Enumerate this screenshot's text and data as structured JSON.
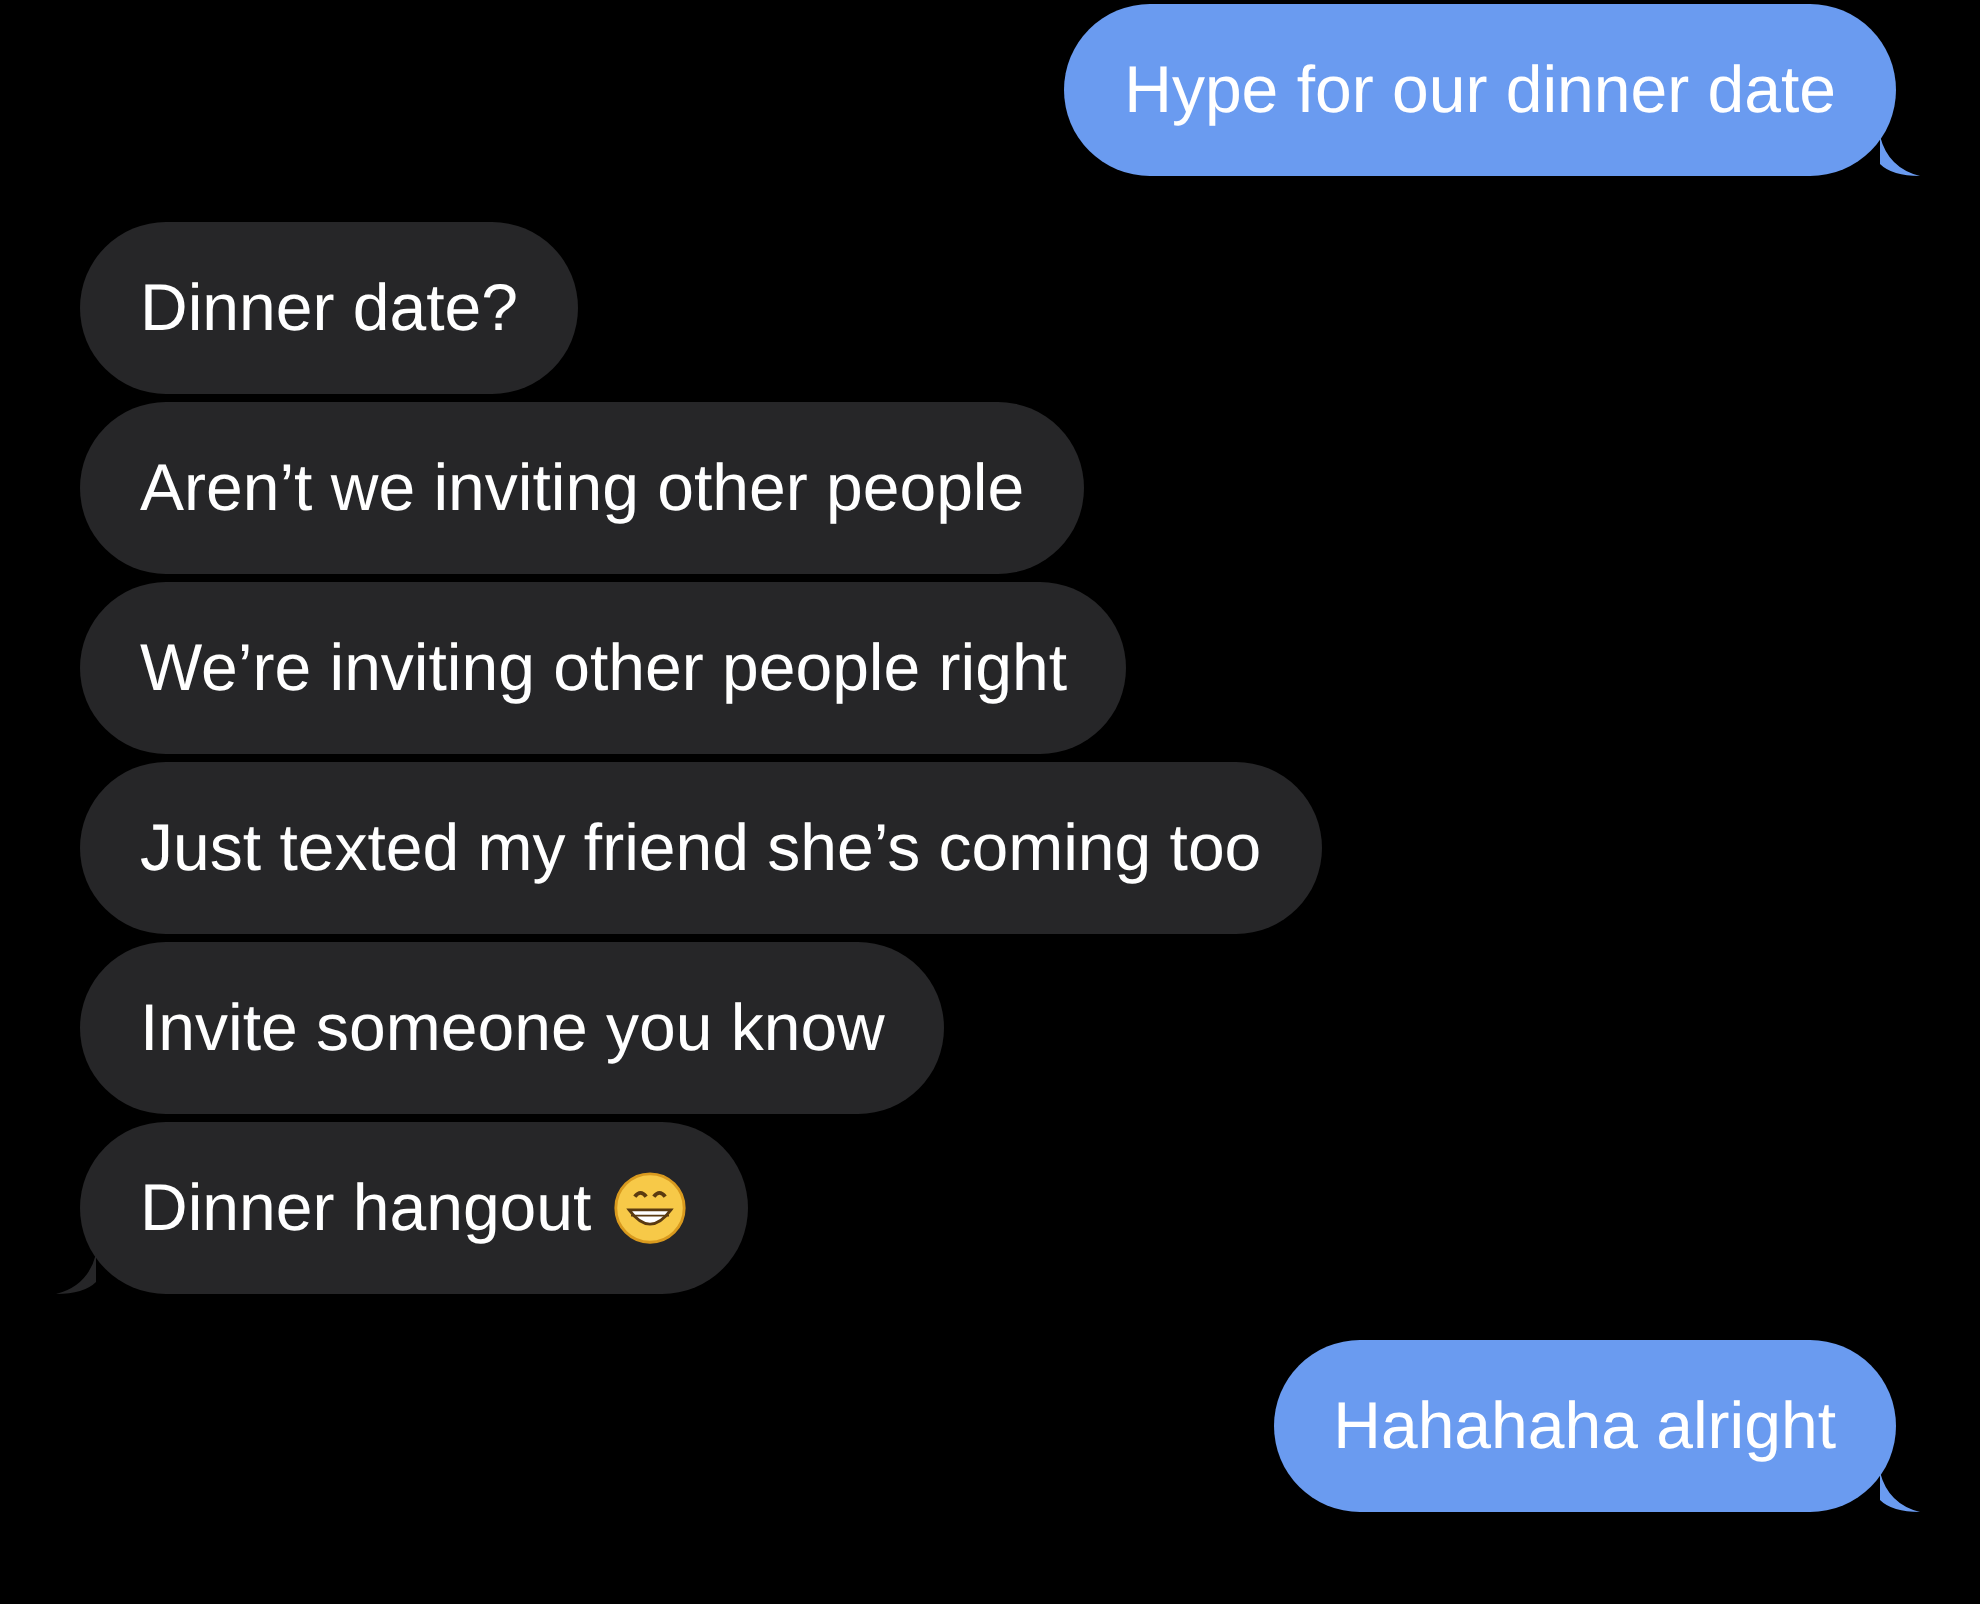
{
  "messages": [
    {
      "kind": "sent",
      "text": "Hype for our dinner date",
      "tail": true,
      "emoji": false
    },
    {
      "kind": "received",
      "text": "Dinner date?",
      "tail": false,
      "emoji": false
    },
    {
      "kind": "received",
      "text": "Aren’t we inviting other people",
      "tail": false,
      "emoji": false
    },
    {
      "kind": "received",
      "text": "We’re inviting other people right",
      "tail": false,
      "emoji": false
    },
    {
      "kind": "received",
      "text": "Just texted my friend she’s coming too",
      "tail": false,
      "emoji": false
    },
    {
      "kind": "received",
      "text": "Invite someone you know",
      "tail": false,
      "emoji": false
    },
    {
      "kind": "received",
      "text": "Dinner hangout",
      "tail": true,
      "emoji": true
    },
    {
      "kind": "sent",
      "text": "Hahahaha alright",
      "tail": true,
      "emoji": false
    }
  ]
}
